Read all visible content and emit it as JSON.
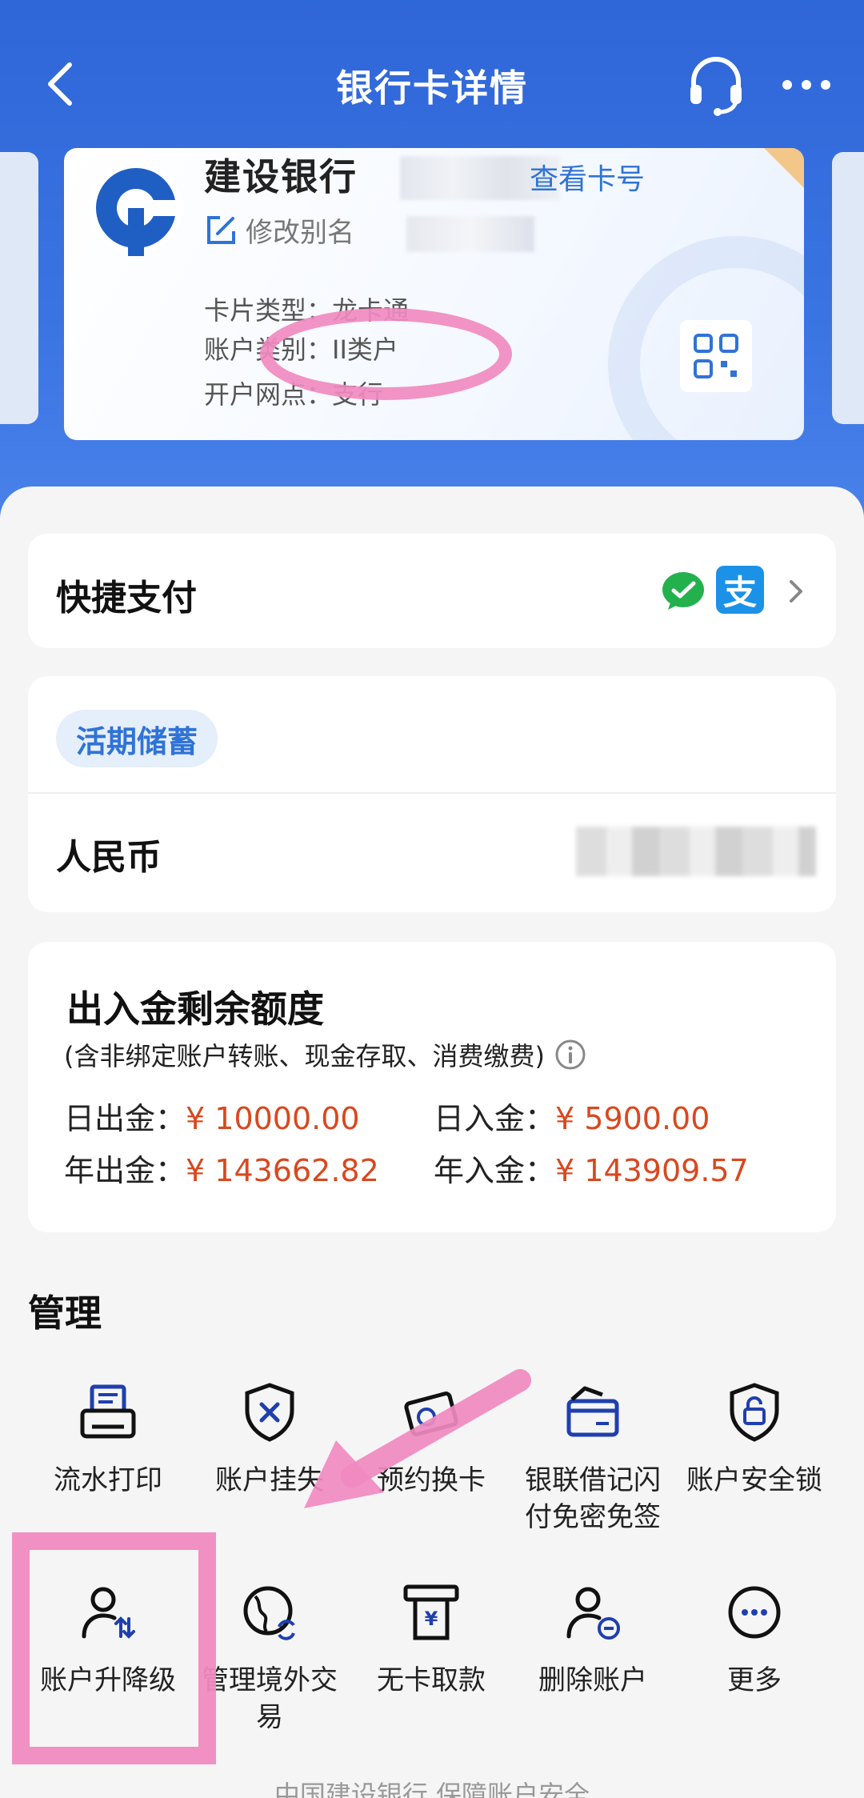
{
  "header": {
    "title": "银行卡详情"
  },
  "card": {
    "bank_name": "建设银行",
    "view_card_no": "查看卡号",
    "edit_alias": "修改别名",
    "card_type_label": "卡片类型：",
    "card_type_value": "龙卡通",
    "account_class_label": "账户类别：",
    "account_class_value": "II类户",
    "branch_label": "开户网点：",
    "branch_value": "支行"
  },
  "quick_pay": {
    "label": "快捷支付"
  },
  "savings": {
    "badge": "活期储蓄",
    "currency": "人民币"
  },
  "quota": {
    "title": "出入金剩余额度",
    "subtitle": "(含非绑定账户转账、现金存取、消费缴费)",
    "daily_out_label": "日出金：",
    "daily_out_value": "¥ 10000.00",
    "daily_in_label": "日入金：",
    "daily_in_value": "¥ 5900.00",
    "yearly_out_label": "年出金：",
    "yearly_out_value": "¥ 143662.82",
    "yearly_in_label": "年入金：",
    "yearly_in_value": "¥ 143909.57"
  },
  "manage": {
    "title": "管理",
    "items": [
      {
        "label": "流水打印"
      },
      {
        "label": "账户挂失"
      },
      {
        "label": "预约换卡"
      },
      {
        "label": "银联借记闪付免密免签"
      },
      {
        "label": "账户安全锁"
      },
      {
        "label": "账户升降级"
      },
      {
        "label": "管理境外交易"
      },
      {
        "label": "无卡取款"
      },
      {
        "label": "删除账户"
      },
      {
        "label": "更多"
      }
    ]
  },
  "footer": {
    "text": "中国建设银行 保障账户安全"
  },
  "colors": {
    "primary": "#2f66d8",
    "link": "#2f73d6",
    "amount": "#d9481f",
    "annotation": "#f08ac0"
  }
}
